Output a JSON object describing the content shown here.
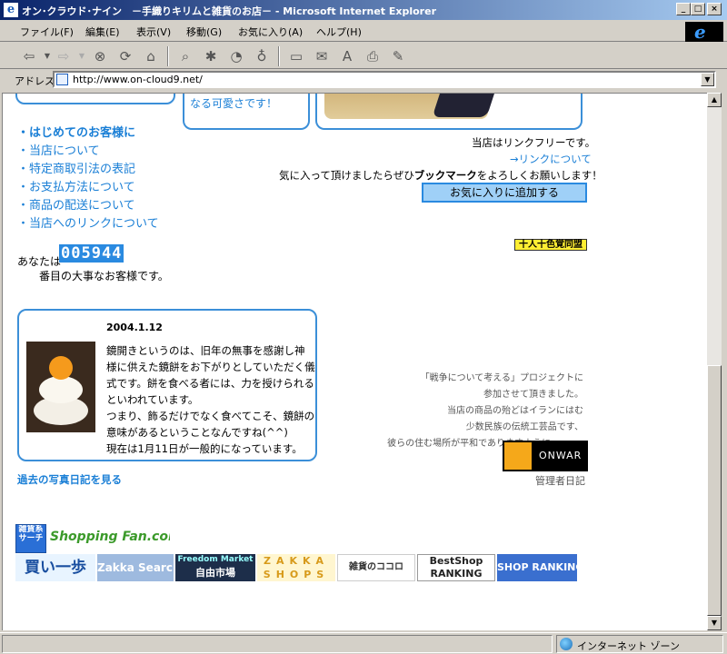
{
  "window": {
    "title": "オン･クラウド･ナイン　－手織りキリムと雑貨のお店－ - Microsoft Internet Explorer",
    "min_glyph": "_",
    "max_glyph": "□",
    "close_glyph": "×"
  },
  "menu": [
    "ファイル(F)",
    "編集(E)",
    "表示(V)",
    "移動(G)",
    "お気に入り(A)",
    "ヘルプ(H)"
  ],
  "address": {
    "label": "アドレス",
    "url": "http://www.on-cloud9.net/"
  },
  "status": {
    "zone": "インターネット ゾーン"
  },
  "page": {
    "cute_text": "なる可愛さです！",
    "nav_links": [
      "・はじめてのお客様に",
      "・当店について",
      "・特定商取引法の表記",
      "・お支払方法について",
      "・商品の配送について",
      "・当店へのリンクについて"
    ],
    "link_free": "当店はリンクフリーです。",
    "about_link": "→リンクについて",
    "bookmark_prefix": "気に入って頂けましたらぜひ",
    "bookmark_bold": "ブックマーク",
    "bookmark_suffix": "をよろしくお願いします！",
    "fav_button": "お気に入りに追加する",
    "ranking_tag": "十人十色覚同盟",
    "visitor_prefix": "あなたは",
    "counter": "005944",
    "visitor_suffix": "番目の大事なお客様です。",
    "diary": {
      "date": "2004.1.12",
      "lines": [
        "鏡開きというのは、旧年の無事を感謝し神",
        "様に供えた鏡餅をお下がりとしていただく儀",
        "式です。餅を食べる者には、力を授けられる",
        "といわれています。",
        "つまり、飾るだけでなく食べてこそ、鏡餅の",
        "意味があるということなんですね(^^)",
        "現在は1月11日が一般的になっています。"
      ]
    },
    "past_diary_link": "過去の写真日記を見る",
    "war_notice": [
      "「戦争について考える」プロジェクトに",
      "参加させて頂きました。",
      "当店の商品の殆どはイランにはむ",
      "少数民族の伝統工芸品です、",
      "彼らの住む場所が平和でありますように・・・。"
    ],
    "onwar_label": "ONWAR",
    "admin_diary": "管理者日記",
    "banners": {
      "zakka_search_label": "雑貨系サーチ",
      "shoppingfan": "Shopping Fan.com",
      "kaiippo": "買い一歩",
      "zakka_search": "Zakka Search",
      "freedom_market_en": "Freedom Market",
      "freedom_market_jp": "自由市場",
      "zakka_shops_top": "ZAKKA",
      "zakka_shops_bottom": "SHOPS",
      "zakka_kokoro": "雑貨のココロ",
      "bestshop": "BestShop",
      "ranking": "RANKING",
      "shop_ranking": "SHOP RANKING"
    }
  }
}
